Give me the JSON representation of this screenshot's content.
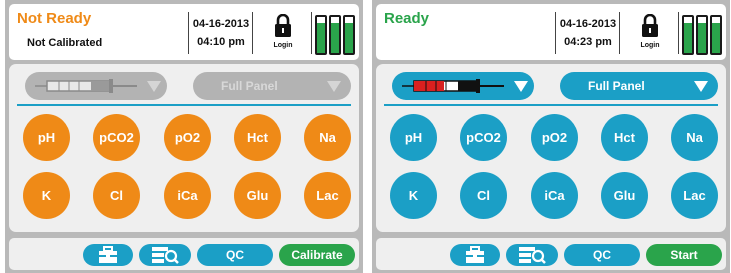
{
  "colors": {
    "orange": "#ef8a17",
    "teal": "#1b9fc6",
    "green": "#2aa44b",
    "disabled_gray": "#b3b3b3",
    "ready_green": "#2aa44b",
    "not_ready_orange": "#ef8a17"
  },
  "screens": [
    {
      "status_title": "Not Ready",
      "status_subtitle": "Not Calibrated",
      "date": "04-16-2013",
      "time": "04:10 pm",
      "login_label": "Login",
      "cartridge_state": "disabled",
      "panel_label": "Full Panel",
      "analytes": [
        "pH",
        "pCO2",
        "pO2",
        "Hct",
        "Na",
        "K",
        "Cl",
        "iCa",
        "Glu",
        "Lac"
      ],
      "qc_label": "QC",
      "action_label": "Calibrate",
      "icons": [
        "lock-icon",
        "battery-icon",
        "dropdown-arrow-icon",
        "toolbox-icon",
        "search-records-icon"
      ]
    },
    {
      "status_title": "Ready",
      "status_subtitle": "",
      "date": "04-16-2013",
      "time": "04:23 pm",
      "login_label": "Login",
      "cartridge_state": "active",
      "panel_label": "Full Panel",
      "analytes": [
        "pH",
        "pCO2",
        "pO2",
        "Hct",
        "Na",
        "K",
        "Cl",
        "iCa",
        "Glu",
        "Lac"
      ],
      "qc_label": "QC",
      "action_label": "Start",
      "icons": [
        "lock-icon",
        "battery-icon",
        "dropdown-arrow-icon",
        "toolbox-icon",
        "search-records-icon"
      ]
    }
  ]
}
